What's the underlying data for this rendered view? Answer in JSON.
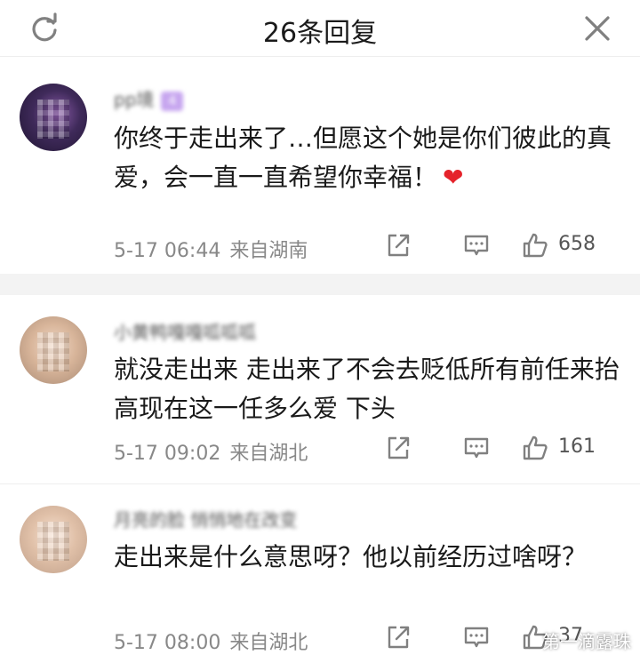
{
  "header": {
    "title": "26条回复"
  },
  "comments": [
    {
      "username": "pp境",
      "badge": "4",
      "text": "你终于走出来了…但愿这个她是你们彼此的真爱，会一直一直希望你幸福！",
      "emoji": "❤",
      "time": "5-17 06:44",
      "location": "来自湖南",
      "likes": "658"
    },
    {
      "username": "小黄鸭嘎嘎呱呱呱",
      "text": "就没走出来 走出来了不会去贬低所有前任来抬高现在这一任多么爱 下头",
      "time": "5-17 09:02",
      "location": "来自湖北",
      "likes": "161"
    },
    {
      "username": "月亮的脸 悄悄地在改变",
      "text": "走出来是什么意思呀？他以前经历过啥呀？",
      "time": "5-17 08:00",
      "location": "来自湖北",
      "likes": "37"
    }
  ],
  "watermark": "第一滴露珠"
}
